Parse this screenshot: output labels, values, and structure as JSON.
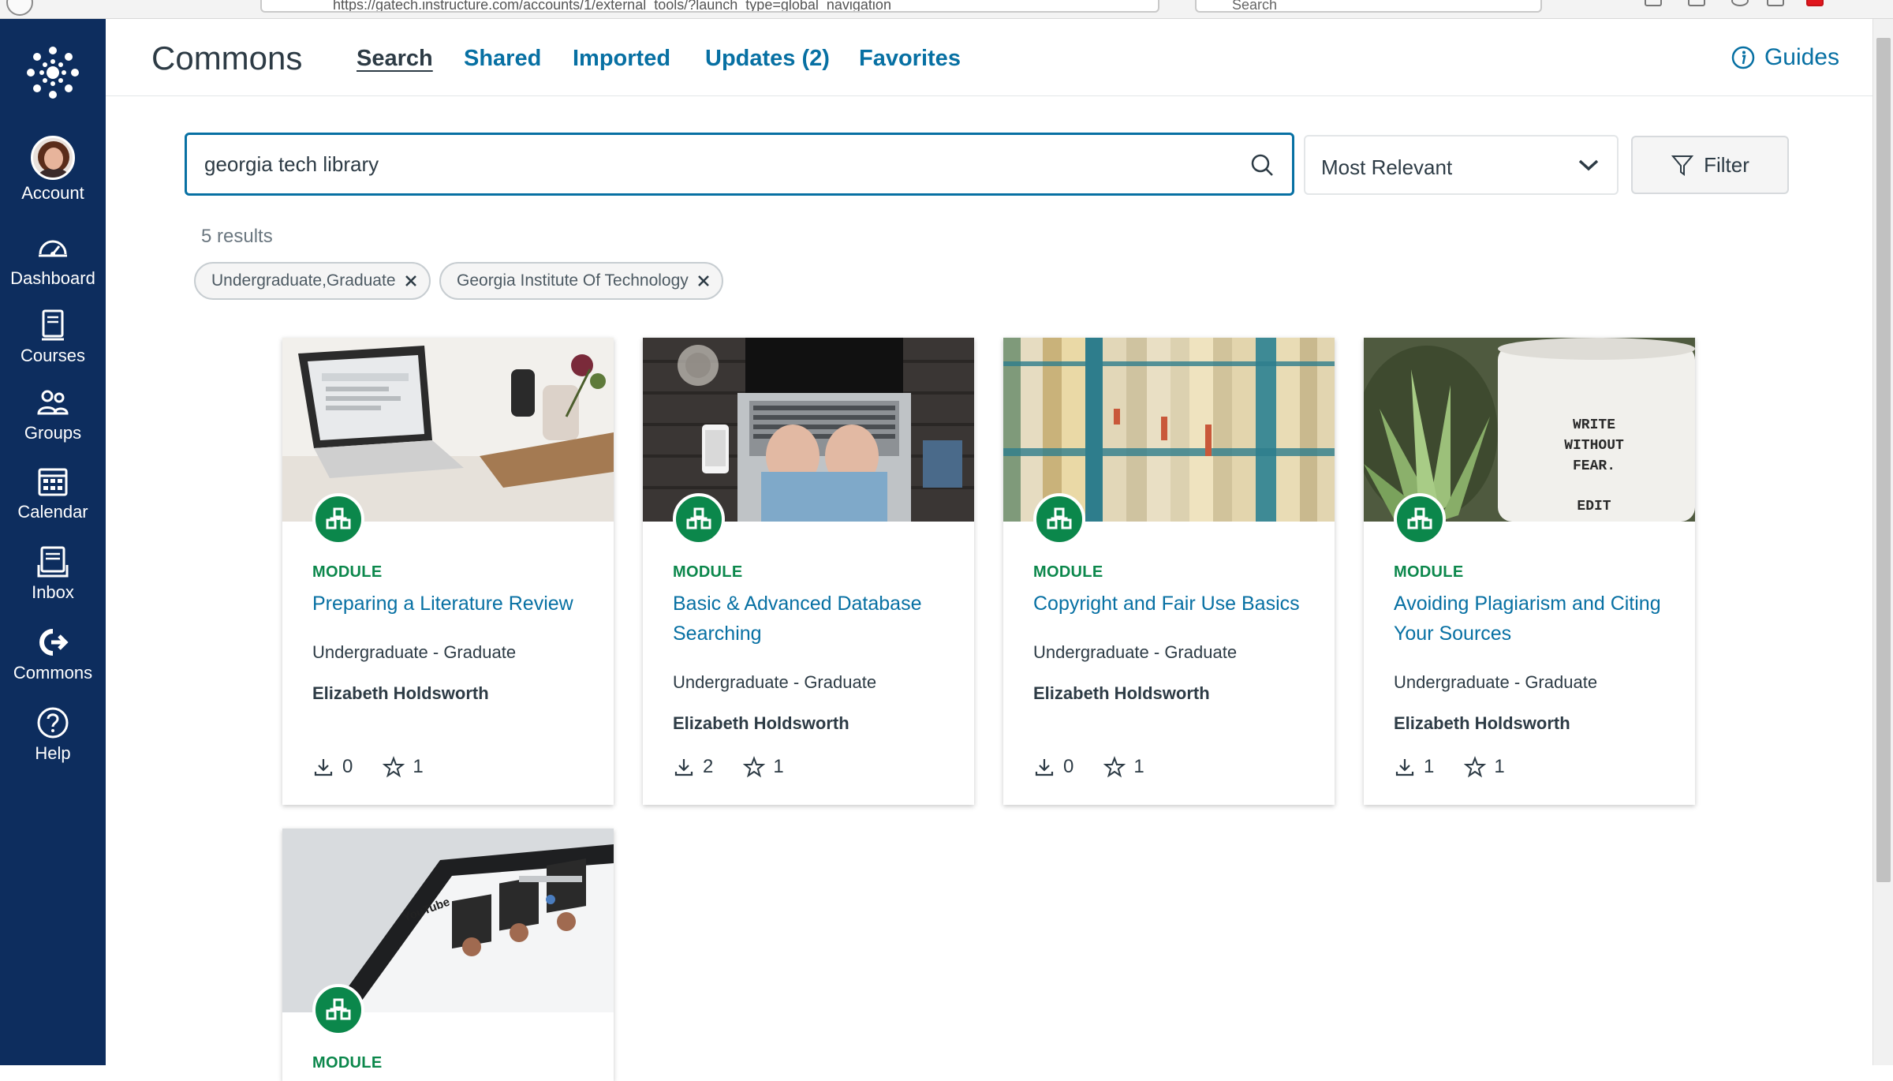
{
  "browser": {
    "url": "https://gatech.instructure.com/accounts/1/external_tools/?launch_type=global_navigation",
    "search_placeholder": "Search"
  },
  "global_nav": {
    "items": [
      {
        "label": "Account",
        "icon": "avatar"
      },
      {
        "label": "Dashboard",
        "icon": "dashboard-icon"
      },
      {
        "label": "Courses",
        "icon": "courses-icon"
      },
      {
        "label": "Groups",
        "icon": "groups-icon"
      },
      {
        "label": "Calendar",
        "icon": "calendar-icon"
      },
      {
        "label": "Inbox",
        "icon": "inbox-icon"
      },
      {
        "label": "Commons",
        "icon": "commons-icon"
      },
      {
        "label": "Help",
        "icon": "help-icon"
      }
    ]
  },
  "header": {
    "brand": "Commons",
    "tabs": [
      "Search",
      "Shared",
      "Imported",
      "Updates (2)",
      "Favorites"
    ],
    "active_tab": "Search",
    "guides": "Guides"
  },
  "search": {
    "value": "georgia tech library",
    "sort": "Most Relevant",
    "filter": "Filter",
    "results": "5 results",
    "pills": [
      "Undergraduate,Graduate",
      "Georgia Institute Of Technology"
    ]
  },
  "cards": [
    {
      "type": "MODULE",
      "title": "Preparing a Literature Review",
      "level": "Undergraduate - Graduate",
      "author": "Elizabeth Holdsworth",
      "downloads": "0",
      "favorites": "1"
    },
    {
      "type": "MODULE",
      "title": "Basic & Advanced Database Searching",
      "level": "Undergraduate - Graduate",
      "author": "Elizabeth Holdsworth",
      "downloads": "2",
      "favorites": "1"
    },
    {
      "type": "MODULE",
      "title": "Copyright and Fair Use Basics",
      "level": "Undergraduate - Graduate",
      "author": "Elizabeth Holdsworth",
      "downloads": "0",
      "favorites": "1"
    },
    {
      "type": "MODULE",
      "title": "Avoiding Plagiarism and Citing Your Sources",
      "level": "Undergraduate - Graduate",
      "author": "Elizabeth Holdsworth",
      "downloads": "1",
      "favorites": "1"
    },
    {
      "type": "MODULE"
    }
  ],
  "card_image_text": {
    "mug": [
      "WRITE",
      "WITHOUT",
      "FEAR.",
      "EDIT"
    ],
    "tablet_logo": "YouTube"
  },
  "colors": {
    "nav_bg": "#0d2d5e",
    "link": "#0770a3",
    "module_green": "#0b874b",
    "text": "#2d3b45"
  }
}
